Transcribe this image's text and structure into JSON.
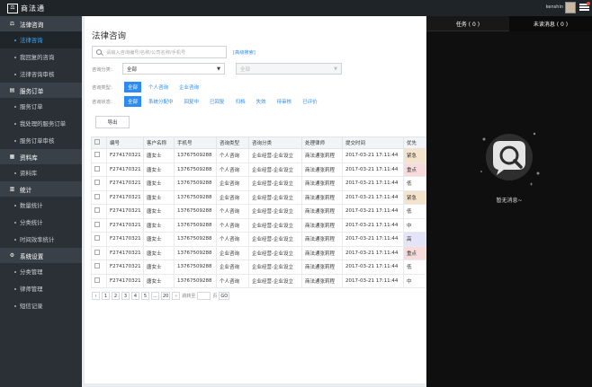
{
  "app": {
    "logo_text": "商法通",
    "user_name": "kenshin"
  },
  "sidebar": {
    "sections": [
      {
        "title": "法律咨询",
        "icon": "scales-icon",
        "items": [
          {
            "label": "法律咨询",
            "active": true
          },
          {
            "label": "我回复的咨询"
          },
          {
            "label": "法律咨询审核"
          }
        ]
      },
      {
        "title": "服务订单",
        "icon": "order-icon",
        "items": [
          {
            "label": "服务订单"
          },
          {
            "label": "我处理的服务订单"
          },
          {
            "label": "服务订单审核"
          }
        ]
      },
      {
        "title": "资料库",
        "icon": "database-icon",
        "items": [
          {
            "label": "资料库"
          }
        ]
      },
      {
        "title": "统计",
        "icon": "chart-icon",
        "items": [
          {
            "label": "数量统计"
          },
          {
            "label": "分类统计"
          },
          {
            "label": "时间效率统计"
          }
        ]
      },
      {
        "title": "系统设置",
        "icon": "gear-icon",
        "items": [
          {
            "label": "分类管理"
          },
          {
            "label": "律师管理"
          },
          {
            "label": "短信记录"
          }
        ]
      }
    ]
  },
  "main": {
    "title": "法律咨询",
    "search_placeholder": "请输入咨询编号/名称/公司名称/手机号",
    "advanced_search": "[高级搜索]",
    "category_label": "咨询分类：",
    "category_value": "全部",
    "sub_category_value": "全部",
    "type_label": "咨询类型：",
    "type_options": [
      "全部",
      "个人咨询",
      "企业咨询"
    ],
    "status_label": "咨询状态：",
    "status_options": [
      "全部",
      "系统分配中",
      "回复中",
      "已回复",
      "归档",
      "失效",
      "待审核",
      "已评价"
    ],
    "export_label": "导出",
    "table": {
      "headers": [
        "编号",
        "客户名称",
        "手机号",
        "咨询类型",
        "咨询分类",
        "处理律师",
        "提交时间",
        "优先"
      ],
      "rows": [
        [
          "F274170321",
          "唐女士",
          "13767509288",
          "个人咨询",
          "企业经营-企业设立",
          "商法通张莉程",
          "2017-03-21 17:11:44",
          "紧急"
        ],
        [
          "F274170321",
          "唐女士",
          "13767509288",
          "个人咨询",
          "企业经营-企业设立",
          "商法通张莉程",
          "2017-03-21 17:11:44",
          "重点"
        ],
        [
          "F274170321",
          "唐女士",
          "13767509288",
          "企业咨询",
          "企业经营-企业设立",
          "商法通张莉程",
          "2017-03-21 17:11:44",
          "低"
        ],
        [
          "F274170321",
          "唐女士",
          "13767509288",
          "企业咨询",
          "企业经营-企业设立",
          "商法通张莉程",
          "2017-03-21 17:11:44",
          "紧急"
        ],
        [
          "F274170321",
          "唐女士",
          "13767509288",
          "个人咨询",
          "企业经营-企业设立",
          "商法通张莉程",
          "2017-03-21 17:11:44",
          "低"
        ],
        [
          "F274170321",
          "唐女士",
          "13767509288",
          "个人咨询",
          "企业经营-企业设立",
          "商法通张莉程",
          "2017-03-21 17:11:44",
          "中"
        ],
        [
          "F274170321",
          "唐女士",
          "13767509288",
          "个人咨询",
          "企业经营-企业设立",
          "商法通张莉程",
          "2017-03-21 17:11:44",
          "高"
        ],
        [
          "F274170321",
          "唐女士",
          "13767509288",
          "企业咨询",
          "企业经营-企业设立",
          "商法通张莉程",
          "2017-03-21 17:11:44",
          "重点"
        ],
        [
          "F274170321",
          "唐女士",
          "13767509288",
          "企业咨询",
          "企业经营-企业设立",
          "商法通张莉程",
          "2017-03-21 17:11:44",
          "低"
        ],
        [
          "F274170321",
          "唐女士",
          "13767509288",
          "个人咨询",
          "企业经营-企业设立",
          "商法通张莉程",
          "2017-03-21 17:11:44",
          "中"
        ]
      ]
    },
    "pager": {
      "prev": "‹",
      "pages": [
        "1",
        "2",
        "3",
        "4",
        "5",
        "...",
        "20"
      ],
      "next": "›",
      "jump_label": "跳转至",
      "page_unit": "页",
      "go_label": "GO"
    }
  },
  "right_panel": {
    "tabs": [
      "任务 ( 0 )",
      "未读消息 ( 0 )"
    ],
    "empty_text": "暂无消息~"
  }
}
